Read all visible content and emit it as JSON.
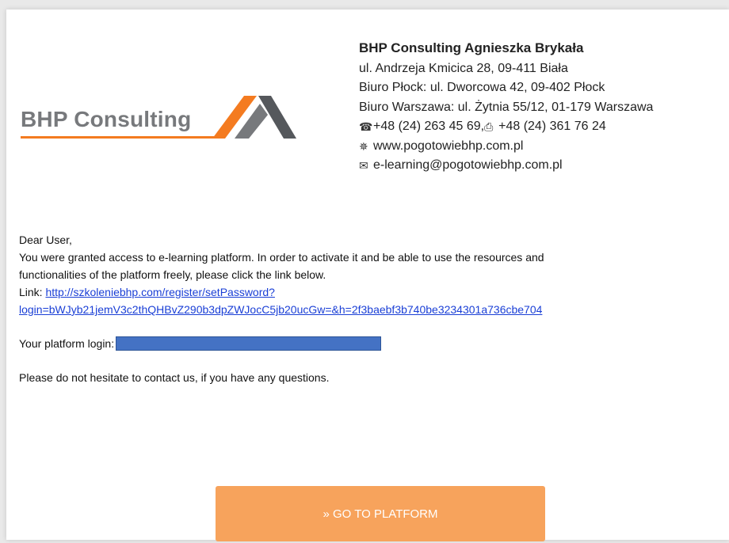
{
  "header": {
    "logo_text": "BHP Consulting",
    "company_name": "BHP Consulting Agnieszka Brykała",
    "address": "ul. Andrzeja Kmicica 28, 09-411 Biała",
    "office_plock": "Biuro Płock: ul. Dworcowa 42, 09-402 Płock",
    "office_warsaw": "Biuro Warszawa: ul. Żytnia 55/12, 01-179 Warszawa",
    "phone": "+48 (24) 263 45 69, ",
    "fax": "+48 (24) 361 76 24",
    "website": "www.pogotowiebhp.com.pl",
    "email": "e-learning@pogotowiebhp.com.pl"
  },
  "body": {
    "greeting": "Dear User,",
    "paragraph_1": "You were granted access to e-learning platform. In order to activate it and be able to use the resources and",
    "paragraph_2": "functionalities of the platform freely, please click the link below.",
    "link_label": "Link: ",
    "link_line_1": "http://szkoleniebhp.com/register/setPassword?",
    "link_line_2": "login=bWJyb21jemV3c2thQHBvZ290b3dpZWJocC5jb20ucGw=&h=2f3baebf3b740be3234301a736cbe704",
    "login_label": "Your platform login:",
    "contact": "Please do not hesitate to contact us, if you have any questions."
  },
  "cta": {
    "label": "» GO TO PLATFORM"
  },
  "colors": {
    "orange": "#f47b20",
    "button": "#f7a35c",
    "link": "#1a3fd6",
    "redaction": "#4472c4"
  }
}
